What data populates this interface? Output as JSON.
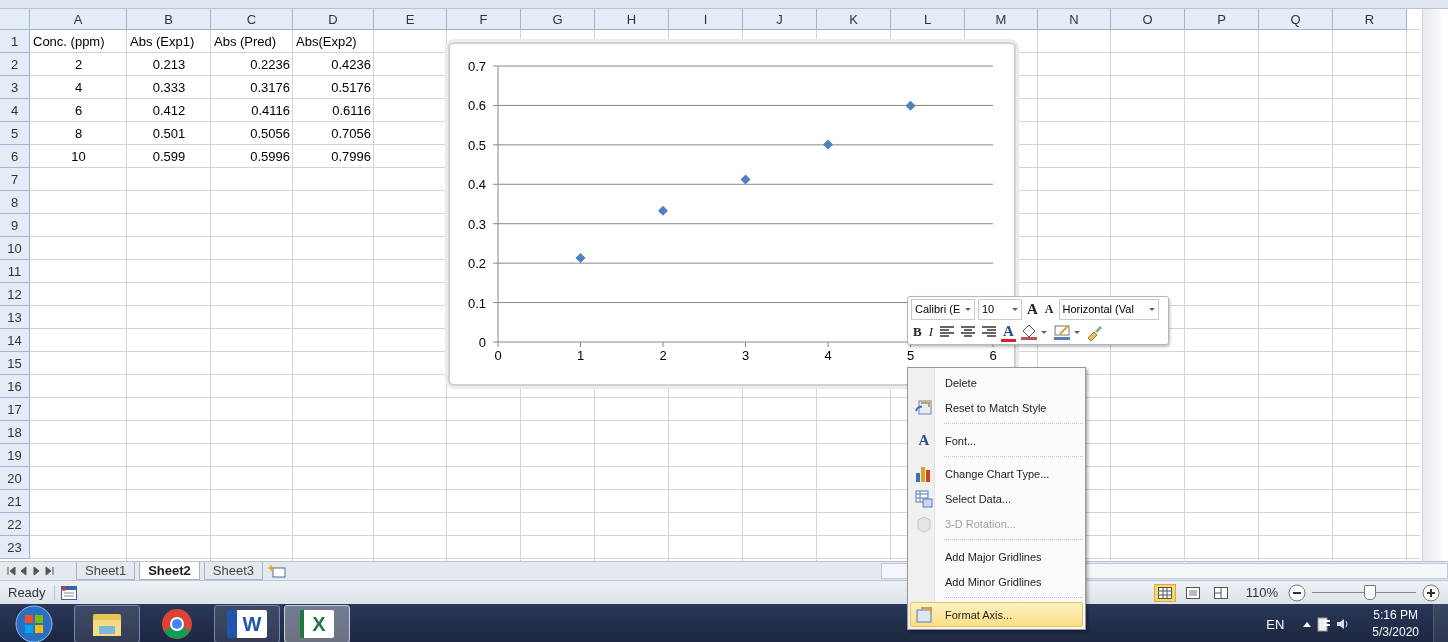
{
  "columns": [
    "A",
    "B",
    "C",
    "D",
    "E",
    "F",
    "G",
    "H",
    "I",
    "J",
    "K",
    "L",
    "M",
    "N",
    "O",
    "P",
    "Q",
    "R"
  ],
  "rows": [
    "1",
    "2",
    "3",
    "4",
    "5",
    "6",
    "7",
    "8",
    "9",
    "10",
    "11",
    "12",
    "13",
    "14",
    "15",
    "16",
    "17",
    "18",
    "19",
    "20",
    "21",
    "22",
    "23"
  ],
  "cells": [
    [
      "Conc. (ppm)",
      "Abs (Exp1)",
      "Abs (Pred)",
      "Abs(Exp2)"
    ],
    [
      "2",
      "0.213",
      "0.2236",
      "0.4236"
    ],
    [
      "4",
      "0.333",
      "0.3176",
      "0.5176"
    ],
    [
      "6",
      "0.412",
      "0.4116",
      "0.6116"
    ],
    [
      "8",
      "0.501",
      "0.5056",
      "0.7056"
    ],
    [
      "10",
      "0.599",
      "0.5996",
      "0.7996"
    ]
  ],
  "chart": {
    "chart_data": {
      "type": "scatter",
      "x": [
        1,
        2,
        3,
        4,
        5
      ],
      "grid": true,
      "series": [
        {
          "color": "#4f81bd",
          "values": [
            0.213,
            0.333,
            0.412,
            0.501,
            0.599
          ]
        }
      ],
      "xlim": [
        0,
        6
      ],
      "ylim": [
        0,
        0.7
      ],
      "xticks": [
        0,
        1,
        2,
        3,
        4,
        5,
        6
      ],
      "yticks": [
        0,
        0.1,
        0.2,
        0.3,
        0.4,
        0.5,
        0.6,
        0.7
      ]
    }
  },
  "mini_toolbar": {
    "font": "Calibri (E",
    "size": "10",
    "grow_font": "A",
    "shrink_font": "A",
    "element": "Horizontal (Val",
    "bold": "B",
    "italic": "I",
    "font_color": "A"
  },
  "context_menu": [
    {
      "kind": "item",
      "label": "Delete",
      "disabled": false,
      "selected": false
    },
    {
      "kind": "item",
      "label": "Reset to Match Style",
      "disabled": false,
      "selected": false
    },
    {
      "kind": "separator"
    },
    {
      "kind": "item",
      "label": "Font...",
      "icon_text": "A",
      "disabled": false,
      "selected": false
    },
    {
      "kind": "separator"
    },
    {
      "kind": "item",
      "label": "Change Chart Type...",
      "disabled": false,
      "selected": false
    },
    {
      "kind": "item",
      "label": "Select Data...",
      "disabled": false,
      "selected": false
    },
    {
      "kind": "item",
      "label": "3-D Rotation...",
      "disabled": true,
      "selected": false
    },
    {
      "kind": "separator"
    },
    {
      "kind": "item",
      "label": "Add Major Gridlines",
      "disabled": false,
      "selected": false
    },
    {
      "kind": "item",
      "label": "Add Minor Gridlines",
      "disabled": false,
      "selected": false
    },
    {
      "kind": "separator"
    },
    {
      "kind": "item",
      "label": "Format Axis...",
      "disabled": false,
      "selected": true
    }
  ],
  "sheet_tabs": [
    {
      "label": "Sheet1",
      "selected": false
    },
    {
      "label": "Sheet2",
      "selected": true
    },
    {
      "label": "Sheet3",
      "selected": false
    }
  ],
  "status_bar": {
    "status": "Ready",
    "views": [
      {
        "kind": "normal",
        "selected": true
      },
      {
        "kind": "page_layout",
        "selected": false
      },
      {
        "kind": "page_break",
        "selected": false
      }
    ],
    "zoom": "110%",
    "zoom_slider": {
      "level": 0.55
    }
  },
  "taskbar": {
    "apps": [
      {
        "kind": "explorer",
        "running": true,
        "active": false
      },
      {
        "kind": "chrome",
        "running": false,
        "active": false
      },
      {
        "kind": "word",
        "glyph": "W",
        "running": true,
        "active": false
      },
      {
        "kind": "excel",
        "glyph": "X",
        "running": true,
        "active": true
      }
    ],
    "language": "EN",
    "time": "5:16 PM",
    "date": "5/3/2020"
  }
}
